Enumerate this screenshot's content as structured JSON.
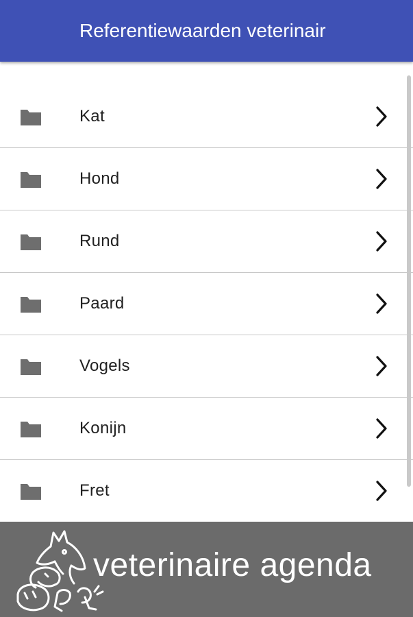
{
  "appbar": {
    "title": "Referentiewaarden veterinair"
  },
  "list": {
    "items": [
      {
        "label": "Kat",
        "icon": "folder-icon"
      },
      {
        "label": "Hond",
        "icon": "folder-icon"
      },
      {
        "label": "Rund",
        "icon": "folder-icon"
      },
      {
        "label": "Paard",
        "icon": "folder-icon"
      },
      {
        "label": "Vogels",
        "icon": "folder-icon"
      },
      {
        "label": "Konijn",
        "icon": "folder-icon"
      },
      {
        "label": "Fret",
        "icon": "folder-icon"
      }
    ]
  },
  "banner": {
    "text": "veterinaire agenda",
    "logo": "horse-logo-icon"
  },
  "colors": {
    "appbar": "#3f51b5",
    "banner": "#6b6b6b",
    "folder": "#6e6e6e",
    "divider": "#c8c8c8"
  }
}
